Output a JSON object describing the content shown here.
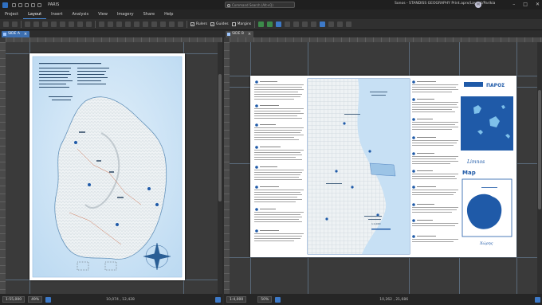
{
  "app": {
    "project_name": "PARIS",
    "search_placeholder": "Command Search (Alt+Q)",
    "window_title": "Sonos - STANDISS GEOGRAPHY Print.aprx/Layout/Parikia",
    "avatar_initials": "M"
  },
  "menu": [
    "Project",
    "Layout",
    "Insert",
    "Analysis",
    "View",
    "Imagery",
    "Share",
    "Help"
  ],
  "ribbon": {
    "rulers": "Rulers",
    "guides": "Guides",
    "margins": "Margins"
  },
  "left_pane": {
    "tab_label": "SIDE A",
    "scale": "1:55,000",
    "zoom": "49%",
    "coords": "10,074 , 12,428"
  },
  "right_pane": {
    "tab_label": "SIDE B",
    "scale": "1:4,000",
    "zoom": "50%",
    "coords": "10,262 , 21,686"
  },
  "side_b": {
    "map_heading": "Map",
    "brand_1": "Limnos",
    "brand_2": "ΠΑΡΟΣ",
    "capital_label": "Χώρης",
    "scale_text": "1:4,000"
  },
  "colors": {
    "accent": "#3d79c7",
    "map_water": "#cfe4f6",
    "map_land": "#e9eef2",
    "brand_blue": "#1f5aa8"
  }
}
